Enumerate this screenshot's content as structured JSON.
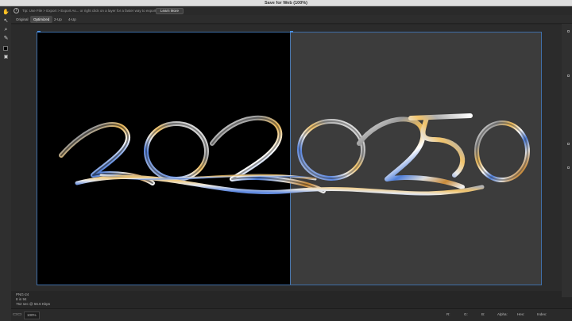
{
  "window": {
    "title": "Save for Web (100%)"
  },
  "infobar": {
    "message": "Tip: Use File > Export > Export As... or right click on a layer for a faster way to export assets",
    "learn_more_label": "Learn More"
  },
  "tools": [
    {
      "name": "hand-tool",
      "glyph": "✋"
    },
    {
      "name": "slice-select-tool",
      "glyph": "↖"
    },
    {
      "name": "zoom-tool",
      "glyph": "🔍"
    },
    {
      "name": "eyedropper-tool",
      "glyph": "✒"
    }
  ],
  "tabs": [
    {
      "label": "Original",
      "active": false
    },
    {
      "label": "Optimized",
      "active": true
    },
    {
      "label": "2-Up",
      "active": false
    },
    {
      "label": "4-Up",
      "active": false
    }
  ],
  "status": {
    "format": "PNG-24",
    "dither": "8 in 94",
    "size_time": "752 sec @ 56.6 Kbps"
  },
  "bottombar": {
    "zoom": "100%",
    "r_label": "R:",
    "g_label": "G:",
    "b_label": "B:",
    "alpha_label": "Alpha:",
    "hex_label": "Hex:",
    "index_label": "Index:"
  },
  "colors": {
    "accent": "#3f6fa8",
    "left_pane_bg": "#000000",
    "right_pane_bg": "#3c3c3c"
  }
}
